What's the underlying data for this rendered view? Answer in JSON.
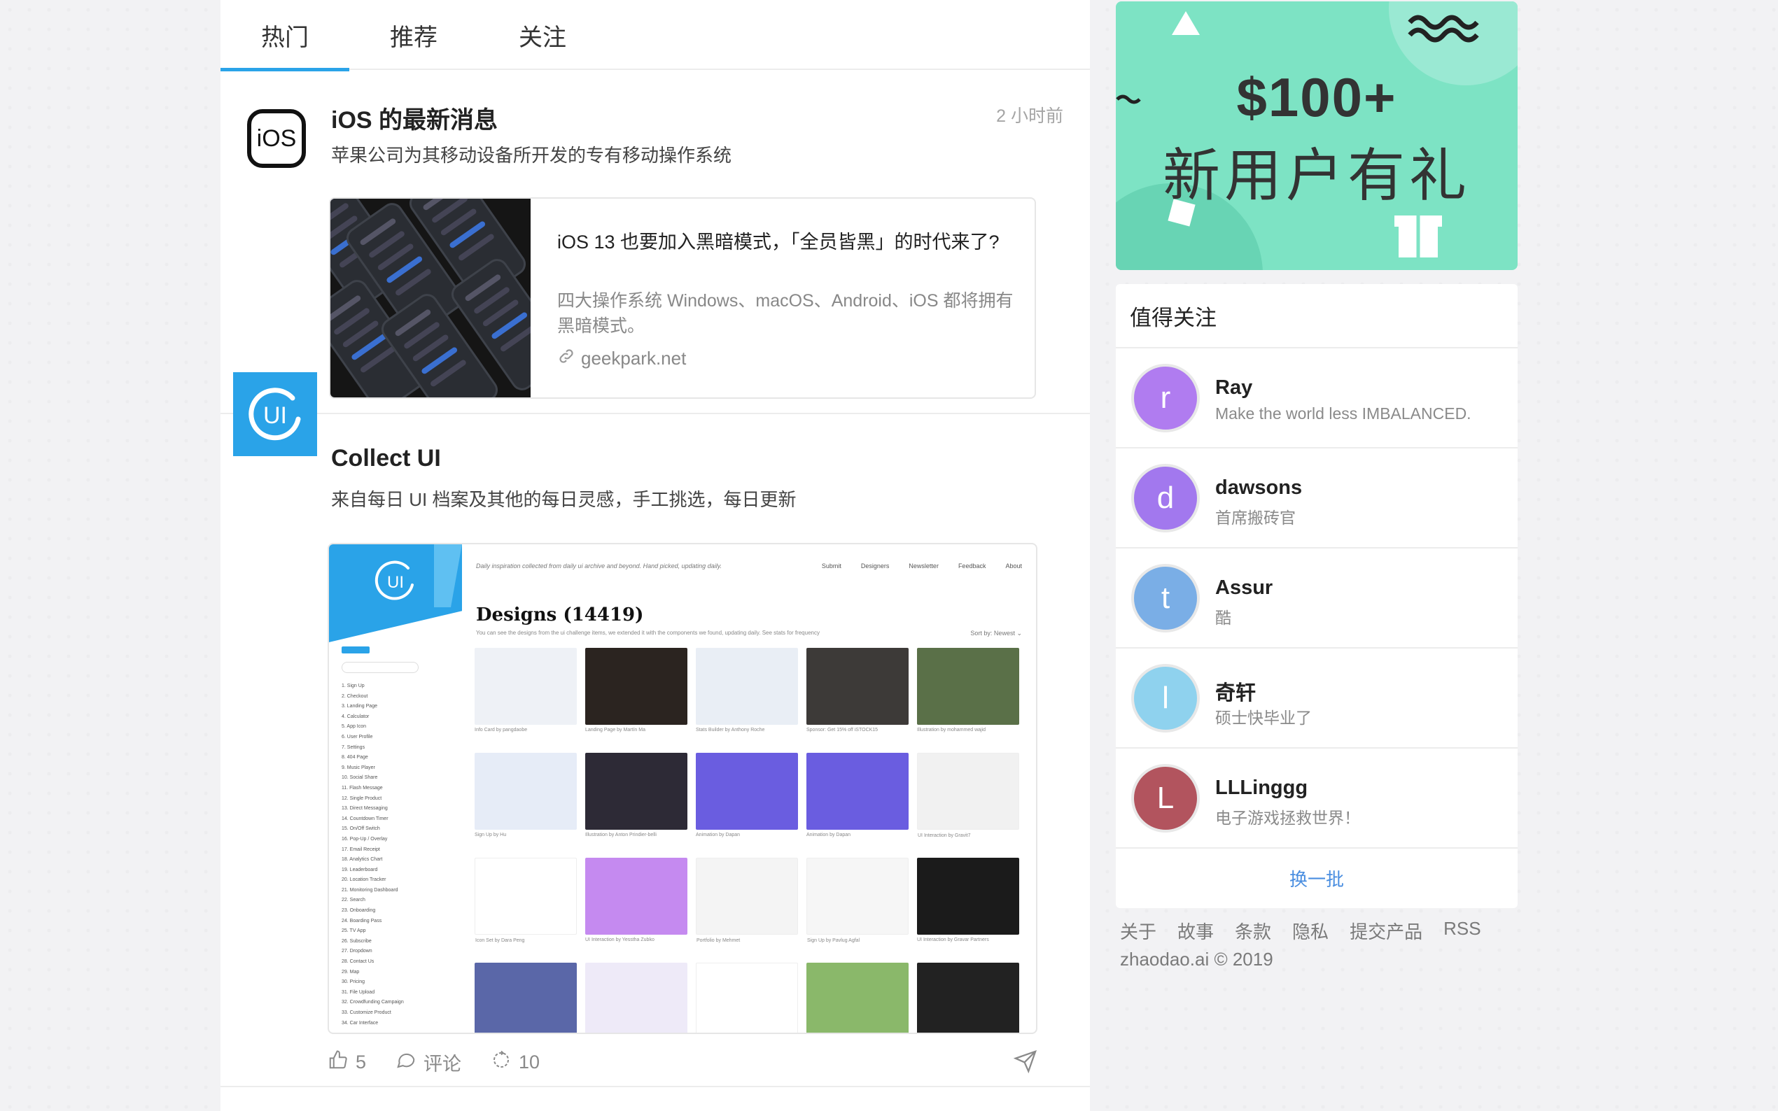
{
  "tabs": [
    {
      "label": "热门",
      "active": true
    },
    {
      "label": "推荐",
      "active": false
    },
    {
      "label": "关注",
      "active": false
    }
  ],
  "posts": [
    {
      "avatar_text": "iOS",
      "title": "iOS 的最新消息",
      "desc": "苹果公司为其移动设备所开发的专有移动操作系统",
      "time": "2 小时前",
      "link": {
        "title": "iOS 13 也要加入黑暗模式，「全员皆黑」的时代来了?",
        "desc": "四大操作系统 Windows、macOS、Android、iOS 都将拥有黑暗模式。",
        "domain": "geekpark.net"
      }
    },
    {
      "avatar_text": "UI",
      "title": "Collect UI",
      "desc": "来自每日 UI 档案及其他的每日灵感，手工挑选，每日更新",
      "screenshot": {
        "logo": "UI",
        "tagline": "Daily inspiration collected from daily ui archive and beyond. Hand picked, updating daily.",
        "nav": [
          "Submit",
          "Designers",
          "Newsletter",
          "Feedback",
          "About"
        ],
        "heading": "Designs (14419)",
        "sub": "You can see the designs from the ui challenge items, we extended it with the components we found, updating daily. See stats for frequency",
        "sort": "Sort by:  Newest ⌄",
        "side_list": [
          "1. Sign Up",
          "2. Checkout",
          "3. Landing Page",
          "4. Calculator",
          "5. App Icon",
          "6. User Profile",
          "7. Settings",
          "8. 404 Page",
          "9. Music Player",
          "10. Social Share",
          "11. Flash Message",
          "12. Single Product",
          "13. Direct Messaging",
          "14. Countdown Timer",
          "15. On/Off Switch",
          "16. Pop-Up / Overlay",
          "17. Email Receipt",
          "18. Analytics Chart",
          "19. Leaderboard",
          "20. Location Tracker",
          "21. Monitoring Dashboard",
          "22. Search",
          "23. Onboarding",
          "24. Boarding Pass",
          "25. TV App",
          "26. Subscribe",
          "27. Dropdown",
          "28. Contact Us",
          "29. Map",
          "30. Pricing",
          "31. File Upload",
          "32. Crowdfunding Campaign",
          "33. Customize Product",
          "34. Car Interface"
        ],
        "captions": [
          "Info Card by pangdaobe",
          "Landing Page by Martín Ma",
          "Stats Builder by Anthony Roche",
          "Sponsor: Get 15% off iSTOCK15",
          "Illustration by mohammed wajid",
          "Sign Up by Hu",
          "Illustration by Anton Prindier-belli",
          "Animation by Dapan",
          "Animation by Dapan",
          "UI Interaction by Gravit7",
          "Icon Set by Dara Peng",
          "UI Interaction by Yesstha Zubko",
          "Portfolio by Mehmet",
          "Sign Up by Pavlug Agfal",
          "UI Interaction by Gravar Partners",
          "",
          "",
          "",
          "",
          ""
        ]
      },
      "actions": {
        "likes": "5",
        "comment_label": "评论",
        "reposts": "10"
      }
    }
  ],
  "promo": {
    "line1": "$100+",
    "line2": "新用户有礼"
  },
  "follow": {
    "title": "值得关注",
    "users": [
      {
        "initial": "r",
        "name": "Ray",
        "bio": "Make the world less IMBALANCED.",
        "color": "#b07cf0"
      },
      {
        "initial": "d",
        "name": "dawsons",
        "bio": "首席搬砖官",
        "color": "#a278ee"
      },
      {
        "initial": "t",
        "name": "Assur",
        "bio": "酷",
        "color": "#7aaee6"
      },
      {
        "initial": "l",
        "name": "奇轩",
        "bio": "硕士快毕业了",
        "color": "#8fd2ee"
      },
      {
        "initial": "L",
        "name": "LLLinggg",
        "bio": "电子游戏拯救世界！",
        "color": "#b2545e"
      }
    ],
    "refresh_label": "换一批"
  },
  "footer": {
    "links": [
      "关于",
      "故事",
      "条款",
      "隐私",
      "提交产品",
      "RSS"
    ],
    "copyright": "zhaodao.ai © 2019"
  }
}
